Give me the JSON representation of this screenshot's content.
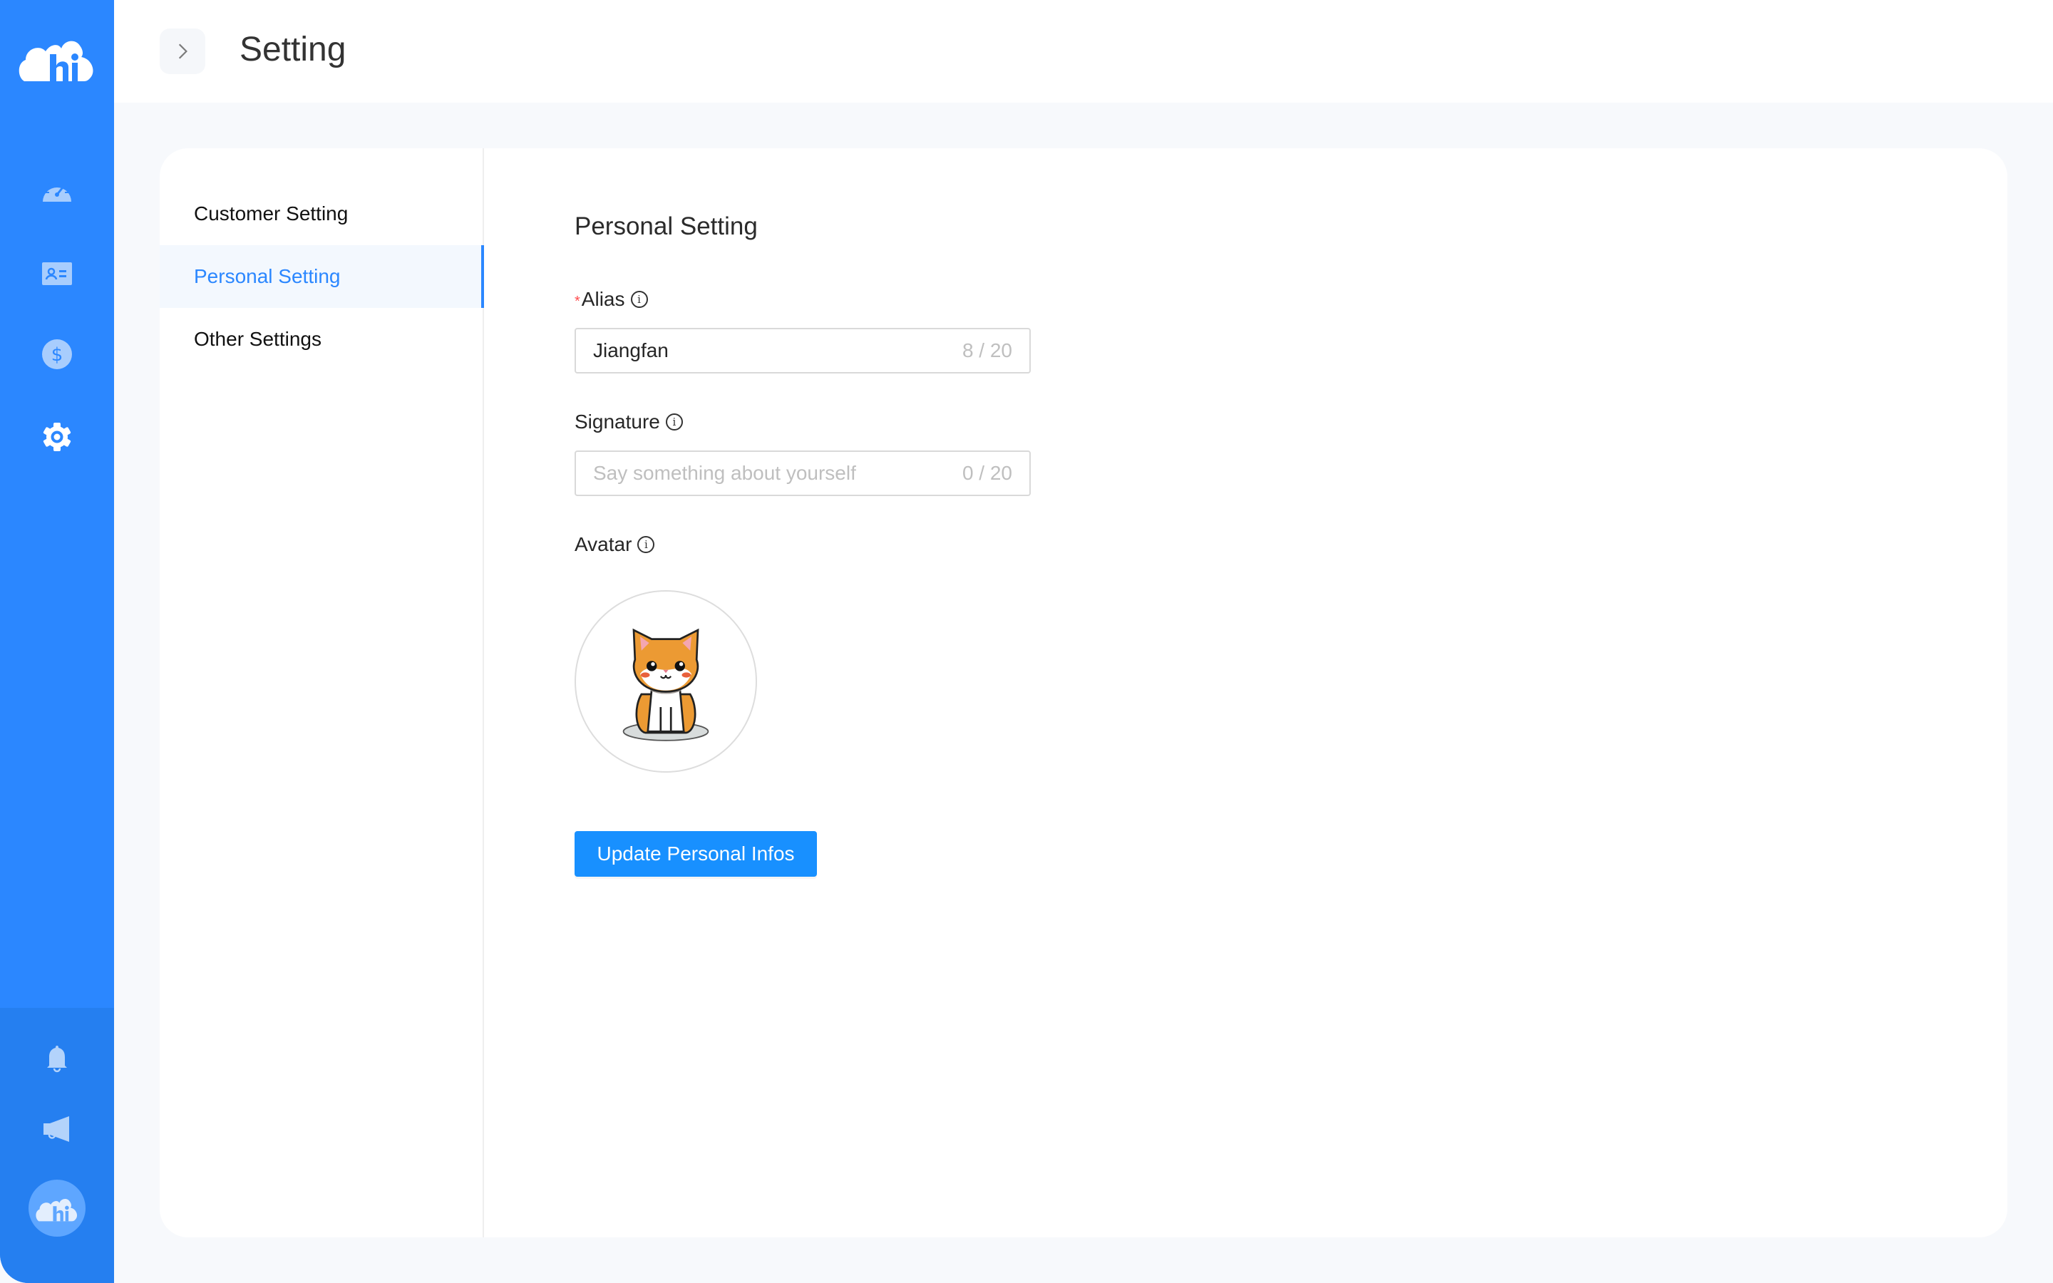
{
  "app": {
    "logo_text": "hi",
    "nav_icons": [
      {
        "name": "dashboard-icon",
        "active": false
      },
      {
        "name": "contact-card-icon",
        "active": false
      },
      {
        "name": "dollar-icon",
        "active": false
      },
      {
        "name": "gear-icon",
        "active": true
      }
    ],
    "bottom_icons": [
      {
        "name": "bell-icon"
      },
      {
        "name": "megaphone-icon"
      }
    ],
    "colors": {
      "sidebar": "#2b87ff",
      "sidebar_bottom": "#257ff0",
      "accent": "#1890ff",
      "required": "#ff4d4f"
    }
  },
  "header": {
    "title": "Setting",
    "toggle_icon": "chevron-right-icon"
  },
  "settings_menu": {
    "items": [
      {
        "label": "Customer Setting",
        "active": false
      },
      {
        "label": "Personal Setting",
        "active": true
      },
      {
        "label": "Other Settings",
        "active": false
      }
    ]
  },
  "form": {
    "title": "Personal Setting",
    "alias": {
      "label": "Alias",
      "required_mark": "*",
      "value": "Jiangfan",
      "counter": "8 / 20"
    },
    "signature": {
      "label": "Signature",
      "value": "",
      "placeholder": "Say something about yourself",
      "counter": "0 / 20"
    },
    "avatar": {
      "label": "Avatar",
      "image": "orange-cat-cartoon"
    },
    "submit_label": "Update Personal Infos"
  }
}
